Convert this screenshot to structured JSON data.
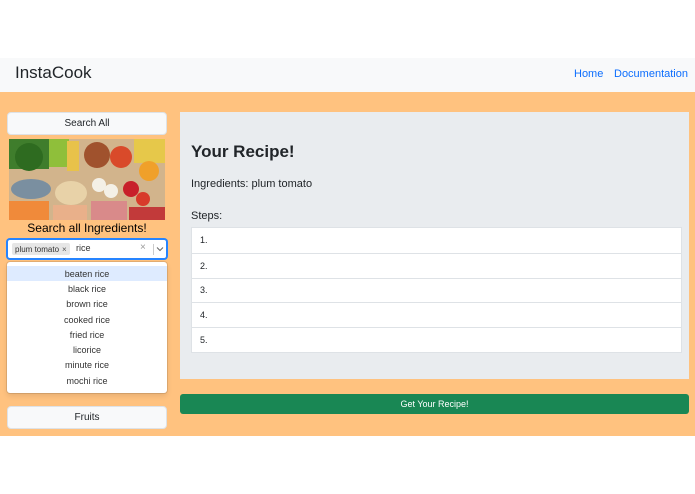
{
  "navbar": {
    "brand": "InstaCook",
    "links": [
      "Home",
      "Documentation"
    ]
  },
  "sidebar": {
    "search_all_label": "Search All",
    "search_title": "Search all Ingredients!",
    "fruits_label": "Fruits",
    "select": {
      "chips": [
        "plum tomato"
      ],
      "input_value": "rice",
      "clear_glyph": "×",
      "chevron_glyph": "⌄"
    },
    "options": [
      "beaten rice",
      "black rice",
      "brown rice",
      "cooked rice",
      "fried rice",
      "licorice",
      "minute rice",
      "mochi rice"
    ],
    "focused_option_index": 0
  },
  "recipe": {
    "title": "Your Recipe!",
    "ingredients": "Ingredients: plum tomato",
    "steps_label": "Steps:",
    "steps": [
      "1.",
      "2.",
      "3.",
      "4.",
      "5."
    ]
  },
  "action": {
    "get_recipe_label": "Get Your Recipe!"
  },
  "colors": {
    "background_accent": "#ffc27f",
    "panel": "#e9ecef",
    "primary_button": "#198754",
    "link": "#0d6efd"
  }
}
